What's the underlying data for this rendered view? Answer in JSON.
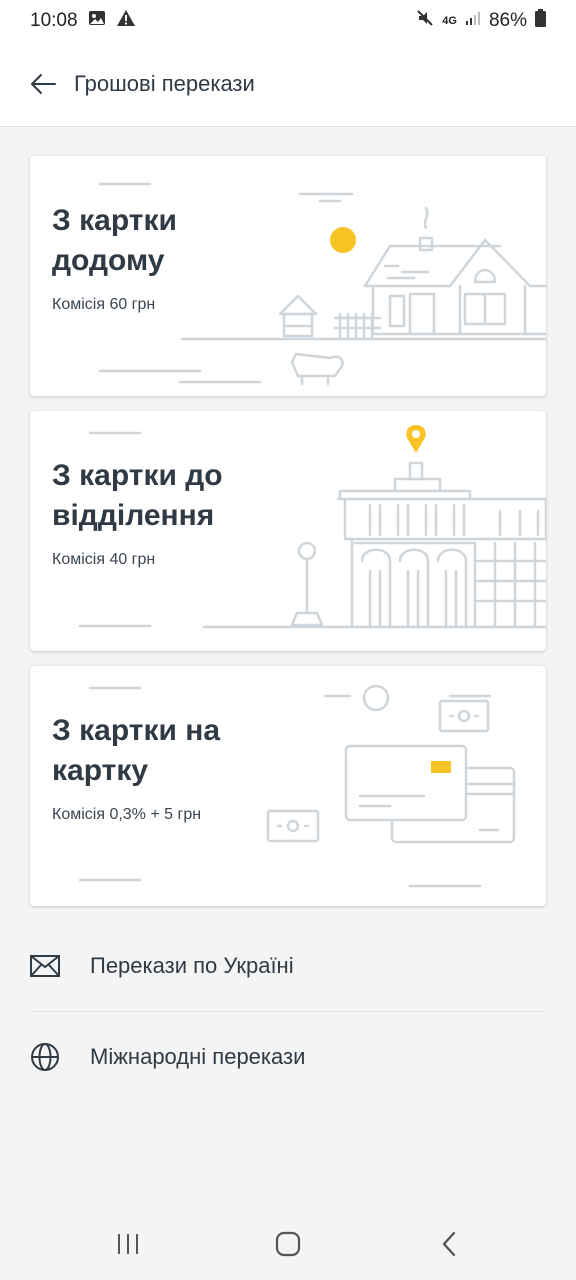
{
  "status_bar": {
    "time": "10:08",
    "battery": "86%",
    "network": "4G",
    "icons": [
      "image-icon",
      "warning-icon",
      "mute-icon",
      "signal-icon",
      "battery-icon"
    ]
  },
  "header": {
    "title": "Грошові перекази",
    "back_icon": "arrow-left-icon"
  },
  "cards": [
    {
      "title": "З картки додому",
      "fee": "Комісія 60 грн",
      "illustration": "house-icon"
    },
    {
      "title": "З картки до відділення",
      "fee": "Комісія 40 грн",
      "illustration": "post-office-icon"
    },
    {
      "title": "З картки на картку",
      "fee": "Комісія 0,3% + 5 грн",
      "illustration": "cards-icon"
    }
  ],
  "links": [
    {
      "label": "Перекази по Україні",
      "icon": "envelope-icon"
    },
    {
      "label": "Міжнародні перекази",
      "icon": "globe-icon"
    }
  ],
  "colors": {
    "accent": "#f7c325",
    "line": "#cfd6db",
    "text": "#2f3a45",
    "background": "#f4f4f4"
  },
  "nav_bar": {
    "icons": [
      "recent-apps-icon",
      "home-icon",
      "back-icon"
    ]
  }
}
